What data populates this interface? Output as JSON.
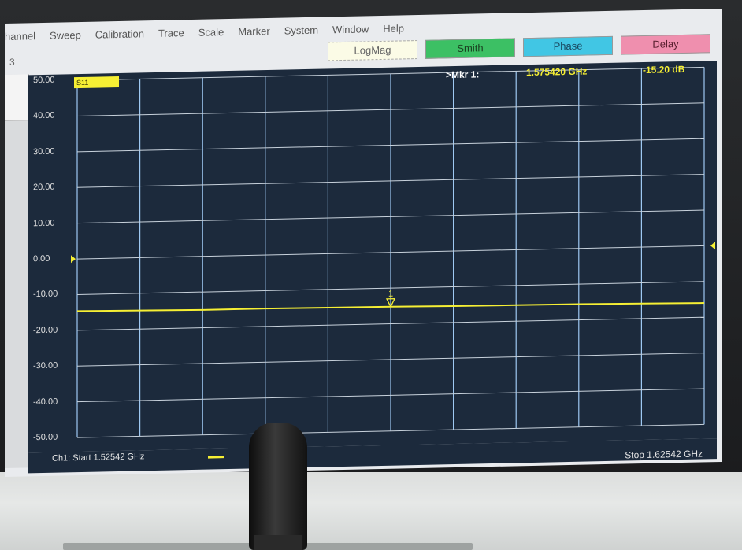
{
  "menu": {
    "items": [
      "hannel",
      "Sweep",
      "Calibration",
      "Trace",
      "Scale",
      "Marker",
      "System",
      "Window",
      "Help"
    ]
  },
  "toolbar": {
    "logmag": "LogMag",
    "smith": "Smith",
    "phase": "Phase",
    "delay": "Delay"
  },
  "left_pane": {
    "tab_number": "3"
  },
  "trace": {
    "badge": "S11"
  },
  "marker": {
    "label": ">Mkr 1:",
    "frequency": "1.575420 GHz",
    "value": "-15.20 dB",
    "number": "1",
    "position_fraction": 0.5
  },
  "y_axis": {
    "ticks": [
      "50.00",
      "40.00",
      "30.00",
      "20.00",
      "10.00",
      "0.00",
      "-10.00",
      "-20.00",
      "-30.00",
      "-40.00",
      "-50.00"
    ],
    "max": 50,
    "min": -50
  },
  "sweep": {
    "start": "Ch1: Start  1.52542 GHz",
    "stop": "Stop  1.62542 GHz"
  },
  "chart_data": {
    "type": "line",
    "x": [
      0,
      0.1,
      0.2,
      0.3,
      0.4,
      0.5,
      0.6,
      0.7,
      0.8,
      0.9,
      1.0
    ],
    "values": [
      -14.6,
      -14.8,
      -15.0,
      -15.0,
      -15.1,
      -15.2,
      -15.4,
      -15.5,
      -15.6,
      -15.8,
      -16.0
    ],
    "ylim": [
      -50,
      50
    ],
    "grid": true,
    "trace_color": "#f6ef34",
    "grid_color": "#6aa8e8"
  }
}
